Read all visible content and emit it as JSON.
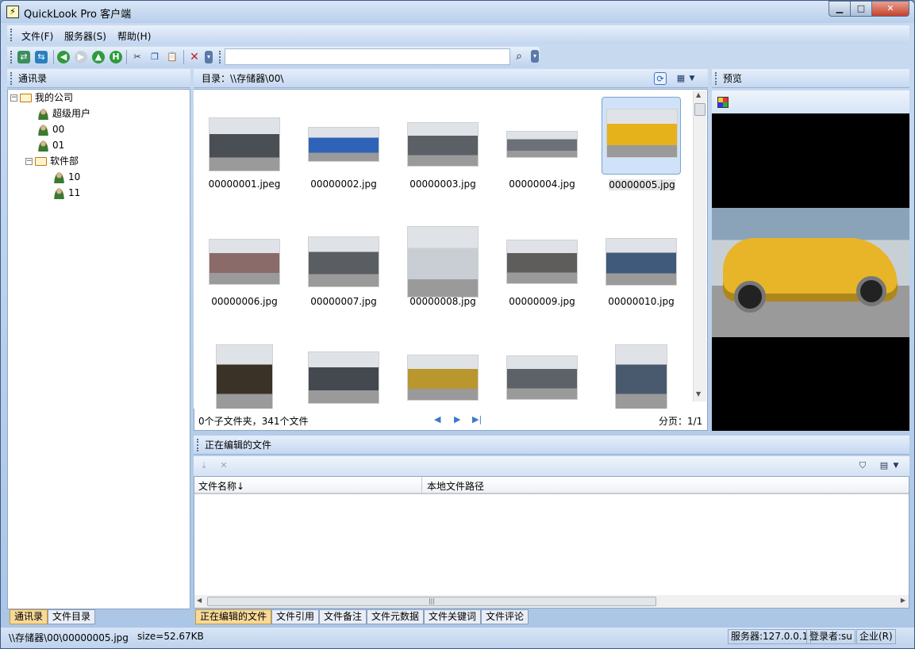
{
  "window": {
    "title": "QuickLook Pro 客户端",
    "min_label": "▁",
    "max_label": "□",
    "close_label": "✕"
  },
  "menu": [
    "文件(F)",
    "服务器(S)",
    "帮助(H)"
  ],
  "search": {
    "value": "",
    "placeholder": ""
  },
  "contacts": {
    "header": "通讯录",
    "tree": [
      {
        "label": "我的公司",
        "type": "folder",
        "level": 0
      },
      {
        "label": "超级用户",
        "type": "user",
        "level": 1
      },
      {
        "label": "00",
        "type": "user",
        "level": 1
      },
      {
        "label": "01",
        "type": "user",
        "level": 1
      },
      {
        "label": "软件部",
        "type": "folder",
        "level": 1
      },
      {
        "label": "10",
        "type": "user",
        "level": 2
      },
      {
        "label": "11",
        "type": "user",
        "level": 2
      }
    ],
    "tabs": [
      "通讯录",
      "文件目录"
    ]
  },
  "directory": {
    "path_label": "目录：\\\\存储器\\00\\",
    "files": [
      {
        "name": "00000001.jpeg",
        "color": "#4a4e55"
      },
      {
        "name": "00000002.jpg",
        "color": "#2f63b8"
      },
      {
        "name": "00000003.jpg",
        "color": "#5b5f66"
      },
      {
        "name": "00000004.jpg",
        "color": "#6d7078"
      },
      {
        "name": "00000005.jpg",
        "color": "#e5b21c",
        "selected": true
      },
      {
        "name": "00000006.jpg",
        "color": "#8a6b6a"
      },
      {
        "name": "00000007.jpg",
        "color": "#5a5e63"
      },
      {
        "name": "00000008.jpg",
        "color": "#c9ced4"
      },
      {
        "name": "00000009.jpg",
        "color": "#5e5d5b"
      },
      {
        "name": "00000010.jpg",
        "color": "#3f5a7a"
      },
      {
        "name": "",
        "color": "#3a3226"
      },
      {
        "name": "",
        "color": "#44484f"
      },
      {
        "name": "",
        "color": "#b9962e"
      },
      {
        "name": "",
        "color": "#5d6168"
      },
      {
        "name": "",
        "color": "#4a5a6e"
      }
    ],
    "status_left": "0个子文件夹，341个文件",
    "status_right": "分页：1/1"
  },
  "preview": {
    "header": "预览",
    "image_color": "#e7b527"
  },
  "editing": {
    "header": "正在编辑的文件",
    "columns": [
      "文件名称↓",
      "本地文件路径"
    ],
    "tabs": [
      "正在编辑的文件",
      "文件引用",
      "文件备注",
      "文件元数据",
      "文件关键词",
      "文件评论"
    ]
  },
  "statusbar": {
    "path": "\\\\存储器\\00\\00000005.jpg",
    "size": "size=52.67KB",
    "server": "服务器:127.0.0.1",
    "login": "登录者:su",
    "edition": "企业(R)"
  }
}
